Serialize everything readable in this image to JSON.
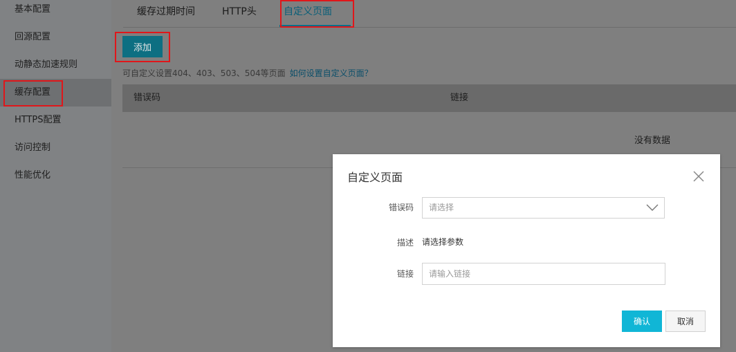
{
  "sidebar": {
    "items": [
      {
        "label": "基本配置"
      },
      {
        "label": "回源配置"
      },
      {
        "label": "动静态加速规则"
      },
      {
        "label": "缓存配置"
      },
      {
        "label": "HTTPS配置"
      },
      {
        "label": "访问控制"
      },
      {
        "label": "性能优化"
      }
    ]
  },
  "tabs": [
    {
      "label": "缓存过期时间"
    },
    {
      "label": "HTTP头"
    },
    {
      "label": "自定义页面"
    }
  ],
  "toolbar": {
    "add_label": "添加"
  },
  "hint": {
    "text": "可自定义设置404、403、503、504等页面",
    "link": "如何设置自定义页面？"
  },
  "table": {
    "columns": [
      "错误码",
      "链接"
    ],
    "empty_text": "没有数据"
  },
  "modal": {
    "title": "自定义页面",
    "error_code_label": "错误码",
    "error_code_placeholder": "请选择",
    "desc_label": "描述",
    "desc_value": "请选择参数",
    "link_label": "链接",
    "link_placeholder": "请输入链接",
    "confirm_label": "确认",
    "cancel_label": "取消"
  },
  "colors": {
    "accent": "#10b6d6",
    "highlight": "#e0161a"
  }
}
